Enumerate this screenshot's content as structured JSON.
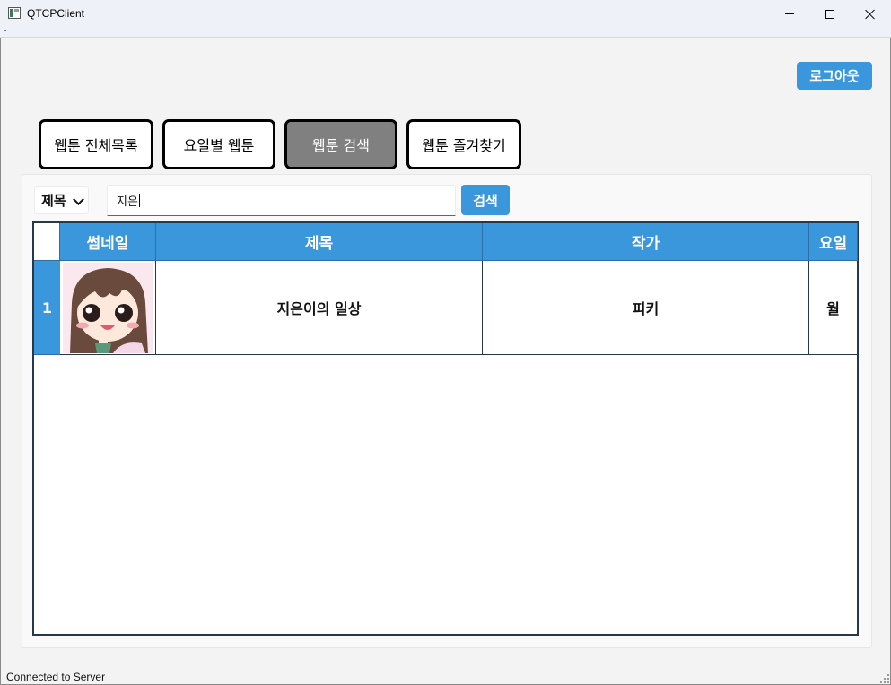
{
  "window": {
    "title": "QTCPClient"
  },
  "header": {
    "logout_label": "로그아웃"
  },
  "nav": {
    "all_label": "웹툰 전체목록",
    "by_day_label": "요일별 웹툰",
    "search_label": "웹툰 검색",
    "favorites_label": "웹툰 즐겨찾기",
    "active": "search"
  },
  "search": {
    "field_selected": "제목",
    "query_value": "지은",
    "button_label": "검색"
  },
  "table": {
    "columns": [
      "썸네일",
      "제목",
      "작가",
      "요일"
    ],
    "rows": [
      {
        "index": "1",
        "thumbnail_icon": "webtoon-character-thumbnail",
        "title": "지은이의 일상",
        "author": "피키",
        "day": "월"
      }
    ]
  },
  "status_bar": {
    "text": "Connected to Server"
  },
  "colors": {
    "accent": "#3a97dc",
    "active_tab": "#808080",
    "table_border": "#25394a"
  }
}
